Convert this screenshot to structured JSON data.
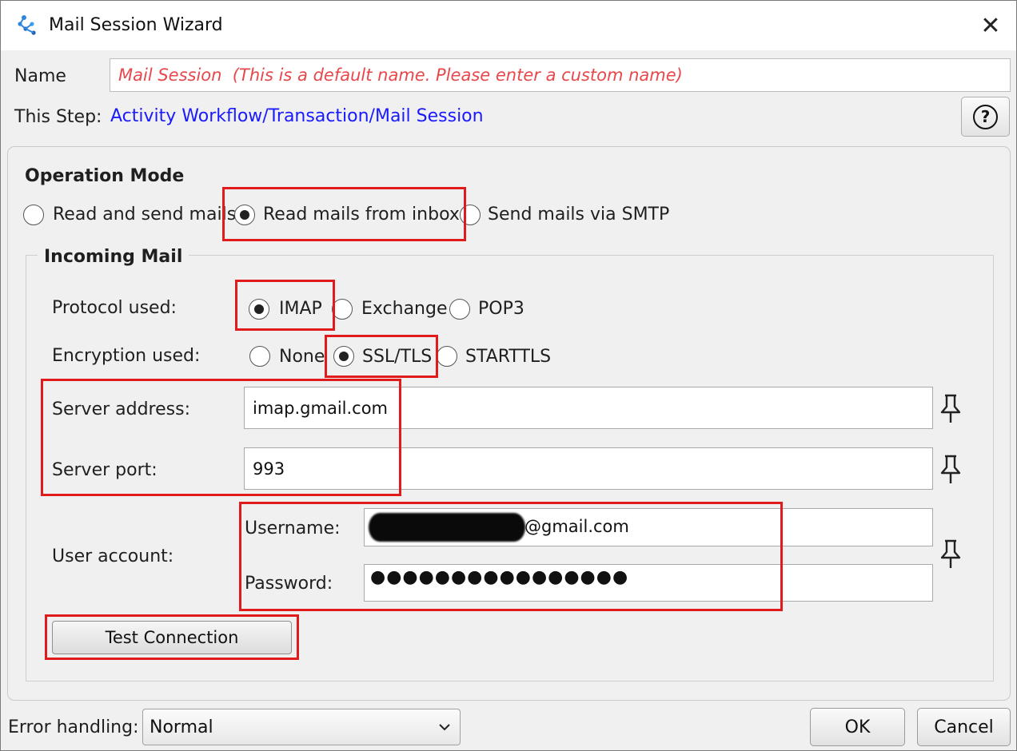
{
  "window": {
    "title": "Mail Session Wizard",
    "close_glyph": "✕"
  },
  "icons": {
    "app": "wizard-logo-icon",
    "close": "close-icon",
    "help": "help-icon",
    "pin": "pin-icon",
    "dropdown": "chevron-down-icon"
  },
  "header": {
    "name_label": "Name",
    "name_placeholder": "Mail Session  (This is a default name. Please enter a custom name)",
    "step_label": "This Step:",
    "step_path": "Activity Workflow/Transaction/Mail Session",
    "help_glyph": "?"
  },
  "operation_mode": {
    "title": "Operation Mode",
    "options": [
      {
        "label": "Read and send mails",
        "checked": false
      },
      {
        "label": "Read mails from inbox",
        "checked": true
      },
      {
        "label": "Send mails via SMTP",
        "checked": false
      }
    ]
  },
  "incoming": {
    "title": "Incoming Mail",
    "protocol_label": "Protocol used:",
    "protocols": [
      {
        "label": "IMAP",
        "checked": true
      },
      {
        "label": "Exchange",
        "checked": false
      },
      {
        "label": "POP3",
        "checked": false
      }
    ],
    "encryption_label": "Encryption used:",
    "encryptions": [
      {
        "label": "None",
        "checked": false
      },
      {
        "label": "SSL/TLS",
        "checked": true
      },
      {
        "label": "STARTTLS",
        "checked": false
      }
    ],
    "server_address_label": "Server address:",
    "server_address": "imap.gmail.com",
    "server_port_label": "Server port:",
    "server_port": "993",
    "user_account_label": "User account:",
    "username_label": "Username:",
    "username_visible_suffix": "@gmail.com",
    "password_label": "Password:",
    "password_mask": "●●●●●●●●●●●●●●●●",
    "test_button": "Test Connection"
  },
  "footer": {
    "error_label": "Error handling:",
    "error_value": "Normal",
    "ok": "OK",
    "cancel": "Cancel"
  },
  "colors": {
    "highlight": "#e01b1b",
    "link": "#1a1aff",
    "placeholder": "#e8474b"
  }
}
